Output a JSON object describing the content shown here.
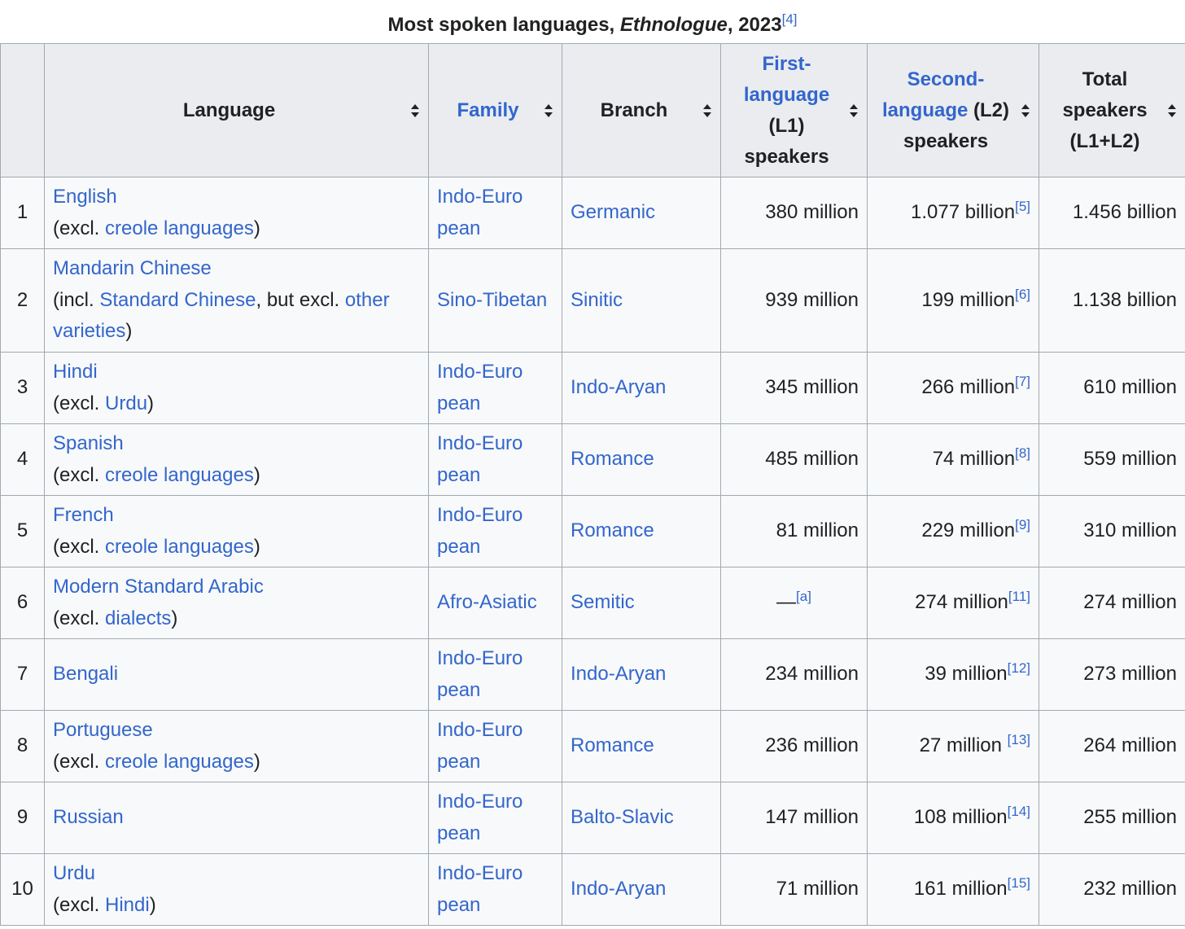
{
  "caption": {
    "title_pre": "Most spoken languages, ",
    "title_italic": "Ethnologue",
    "title_post": ", 2023",
    "ref": "[4]"
  },
  "headers": {
    "rank": "",
    "language": "Language",
    "family": "Family",
    "branch": "Branch",
    "l1_link": "First-language",
    "l1_rest": "(L1) speakers",
    "l2_link": "Second-language",
    "l2_rest": "(L2) speakers",
    "total": "Total speakers (L1+L2)"
  },
  "rows": [
    {
      "rank": "1",
      "lang": "English",
      "note_pre": "(excl. ",
      "note_link1": "creole languages",
      "note_mid": "",
      "note_link2": "",
      "note_post": ")",
      "family": "Indo-European",
      "branch": "Germanic",
      "l1": "380 million",
      "l1_ref": "",
      "l2": "1.077 billion",
      "l2_ref": "[5]",
      "total": "1.456 billion"
    },
    {
      "rank": "2",
      "lang": "Mandarin Chinese",
      "note_pre": "(incl. ",
      "note_link1": "Standard Chinese",
      "note_mid": ", but excl. ",
      "note_link2": "other varieties",
      "note_post": ")",
      "family": "Sino-Tibetan",
      "branch": "Sinitic",
      "l1": "939 million",
      "l1_ref": "",
      "l2": "199 million",
      "l2_ref": "[6]",
      "total": "1.138 billion"
    },
    {
      "rank": "3",
      "lang": "Hindi",
      "note_pre": "(excl. ",
      "note_link1": "Urdu",
      "note_mid": "",
      "note_link2": "",
      "note_post": ")",
      "family": "Indo-European",
      "branch": "Indo-Aryan",
      "l1": "345 million",
      "l1_ref": "",
      "l2": "266 million",
      "l2_ref": "[7]",
      "total": "610 million"
    },
    {
      "rank": "4",
      "lang": "Spanish",
      "note_pre": "(excl. ",
      "note_link1": "creole languages",
      "note_mid": "",
      "note_link2": "",
      "note_post": ")",
      "family": "Indo-European",
      "branch": "Romance",
      "l1": "485 million",
      "l1_ref": "",
      "l2": "74 million",
      "l2_ref": "[8]",
      "total": "559 million"
    },
    {
      "rank": "5",
      "lang": "French",
      "note_pre": "(excl. ",
      "note_link1": "creole languages",
      "note_mid": "",
      "note_link2": "",
      "note_post": ")",
      "family": "Indo-European",
      "branch": "Romance",
      "l1": "81 million",
      "l1_ref": "",
      "l2": "229 million",
      "l2_ref": "[9]",
      "total": "310 million"
    },
    {
      "rank": "6",
      "lang": "Modern Standard Arabic",
      "note_pre": "(excl. ",
      "note_link1": "dialects",
      "note_mid": "",
      "note_link2": "",
      "note_post": ")",
      "family": "Afro-Asiatic",
      "branch": "Semitic",
      "l1": "—",
      "l1_ref": "[a]",
      "l2": "274 million",
      "l2_ref": "[11]",
      "total": "274 million"
    },
    {
      "rank": "7",
      "lang": "Bengali",
      "note_pre": "",
      "note_link1": "",
      "note_mid": "",
      "note_link2": "",
      "note_post": "",
      "family": "Indo-European",
      "branch": "Indo-Aryan",
      "l1": "234 million",
      "l1_ref": "",
      "l2": "39 million",
      "l2_ref": "[12]",
      "total": "273 million"
    },
    {
      "rank": "8",
      "lang": "Portuguese",
      "note_pre": "(excl. ",
      "note_link1": "creole languages",
      "note_mid": "",
      "note_link2": "",
      "note_post": ")",
      "family": "Indo-European",
      "branch": "Romance",
      "l1": "236 million",
      "l1_ref": "",
      "l2": "27 million ",
      "l2_ref": "[13]",
      "total": "264 million"
    },
    {
      "rank": "9",
      "lang": "Russian",
      "note_pre": "",
      "note_link1": "",
      "note_mid": "",
      "note_link2": "",
      "note_post": "",
      "family": "Indo-European",
      "branch": "Balto-Slavic",
      "l1": "147 million",
      "l1_ref": "",
      "l2": "108 million",
      "l2_ref": "[14]",
      "total": "255 million"
    },
    {
      "rank": "10",
      "lang": "Urdu",
      "note_pre": "(excl. ",
      "note_link1": "Hindi",
      "note_mid": "",
      "note_link2": "",
      "note_post": ")",
      "family": "Indo-European",
      "branch": "Indo-Aryan",
      "l1": "71 million",
      "l1_ref": "",
      "l2": "161 million",
      "l2_ref": "[15]",
      "total": "232 million"
    }
  ],
  "colors": {
    "link": "#3366cc",
    "header_bg": "#eaecf0",
    "cell_bg": "#f8f9fa",
    "border": "#a2a9b1",
    "text": "#202122"
  },
  "icons": {
    "sort": "sort-arrows-icon"
  }
}
